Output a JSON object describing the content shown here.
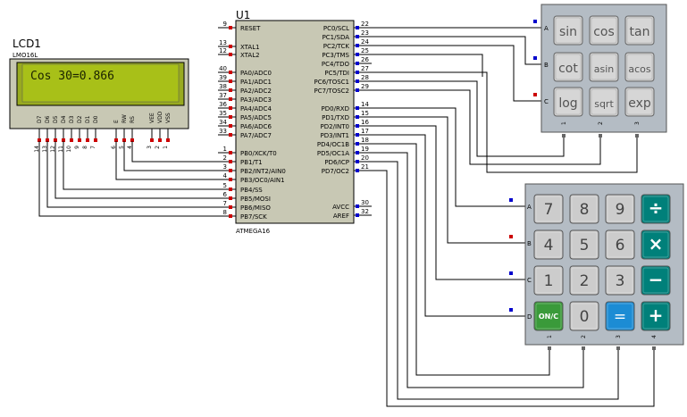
{
  "lcd": {
    "ref": "LCD1",
    "model": "LMO16L",
    "display_text": "Cos 30=0.866",
    "pins": [
      {
        "name": "D7",
        "num": "14"
      },
      {
        "name": "D6",
        "num": "13"
      },
      {
        "name": "D5",
        "num": "12"
      },
      {
        "name": "D4",
        "num": "11"
      },
      {
        "name": "D3",
        "num": "10"
      },
      {
        "name": "D2",
        "num": "9"
      },
      {
        "name": "D1",
        "num": "8"
      },
      {
        "name": "D0",
        "num": "7"
      },
      {
        "name": "E",
        "num": "6"
      },
      {
        "name": "RW",
        "num": "5"
      },
      {
        "name": "RS",
        "num": "4"
      },
      {
        "name": "VEE",
        "num": "3"
      },
      {
        "name": "VDD",
        "num": "2"
      },
      {
        "name": "VSS",
        "num": "1"
      }
    ]
  },
  "mcu": {
    "ref": "U1",
    "part": "ATMEGA16",
    "left_pins": [
      {
        "num": "9",
        "label": "RESET"
      },
      {
        "num": "13",
        "label": "XTAL1"
      },
      {
        "num": "12",
        "label": "XTAL2"
      },
      {
        "num": "40",
        "label": "PA0/ADC0"
      },
      {
        "num": "39",
        "label": "PA1/ADC1"
      },
      {
        "num": "38",
        "label": "PA2/ADC2"
      },
      {
        "num": "37",
        "label": "PA3/ADC3"
      },
      {
        "num": "36",
        "label": "PA4/ADC4"
      },
      {
        "num": "35",
        "label": "PA5/ADC5"
      },
      {
        "num": "34",
        "label": "PA6/ADC6"
      },
      {
        "num": "33",
        "label": "PA7/ADC7"
      },
      {
        "num": "1",
        "label": "PB0/XCK/T0"
      },
      {
        "num": "2",
        "label": "PB1/T1"
      },
      {
        "num": "3",
        "label": "PB2/INT2/AIN0"
      },
      {
        "num": "4",
        "label": "PB3/OC0/AIN1"
      },
      {
        "num": "5",
        "label": "PB4/SS"
      },
      {
        "num": "6",
        "label": "PB5/MOSI"
      },
      {
        "num": "7",
        "label": "PB6/MISO"
      },
      {
        "num": "8",
        "label": "PB7/SCK"
      }
    ],
    "right_pins": [
      {
        "num": "22",
        "label": "PC0/SCL"
      },
      {
        "num": "23",
        "label": "PC1/SDA"
      },
      {
        "num": "24",
        "label": "PC2/TCK"
      },
      {
        "num": "25",
        "label": "PC3/TMS"
      },
      {
        "num": "26",
        "label": "PC4/TDO"
      },
      {
        "num": "27",
        "label": "PC5/TDI"
      },
      {
        "num": "28",
        "label": "PC6/TOSC1"
      },
      {
        "num": "29",
        "label": "PC7/TOSC2"
      },
      {
        "num": "14",
        "label": "PD0/RXD"
      },
      {
        "num": "15",
        "label": "PD1/TXD"
      },
      {
        "num": "16",
        "label": "PD2/INT0"
      },
      {
        "num": "17",
        "label": "PD3/INT1"
      },
      {
        "num": "18",
        "label": "PD4/OC1B"
      },
      {
        "num": "19",
        "label": "PD5/OC1A"
      },
      {
        "num": "20",
        "label": "PD6/ICP"
      },
      {
        "num": "21",
        "label": "PD7/OC2"
      },
      {
        "num": "30",
        "label": "AVCC"
      },
      {
        "num": "32",
        "label": "AREF"
      }
    ]
  },
  "keypad_sci": {
    "rows": [
      "A",
      "B",
      "C"
    ],
    "cols": [
      "1",
      "2",
      "3"
    ],
    "keys": [
      [
        "sin",
        "cos",
        "tan"
      ],
      [
        "cot",
        "asin",
        "acos"
      ],
      [
        "log",
        "sqrt",
        "exp"
      ]
    ]
  },
  "keypad_calc": {
    "rows": [
      "A",
      "B",
      "C",
      "D"
    ],
    "cols": [
      "1",
      "2",
      "3",
      "4"
    ],
    "keys": [
      [
        "7",
        "8",
        "9",
        "÷"
      ],
      [
        "4",
        "5",
        "6",
        "×"
      ],
      [
        "1",
        "2",
        "3",
        "−"
      ],
      [
        "ON/C",
        "0",
        "=",
        "+"
      ]
    ]
  },
  "colors": {
    "chip_fill": "#c8c8b4",
    "lcd_screen": "#a8c018",
    "keypad_body": "#b4bcc4",
    "key_face": "#cccccc",
    "teal_key": "#00807a",
    "blue_key": "#1c8cd4",
    "green_key": "#3a9a3a",
    "wire": "#000000",
    "pin_red": "#cc0000",
    "pin_blue": "#0000cc"
  }
}
